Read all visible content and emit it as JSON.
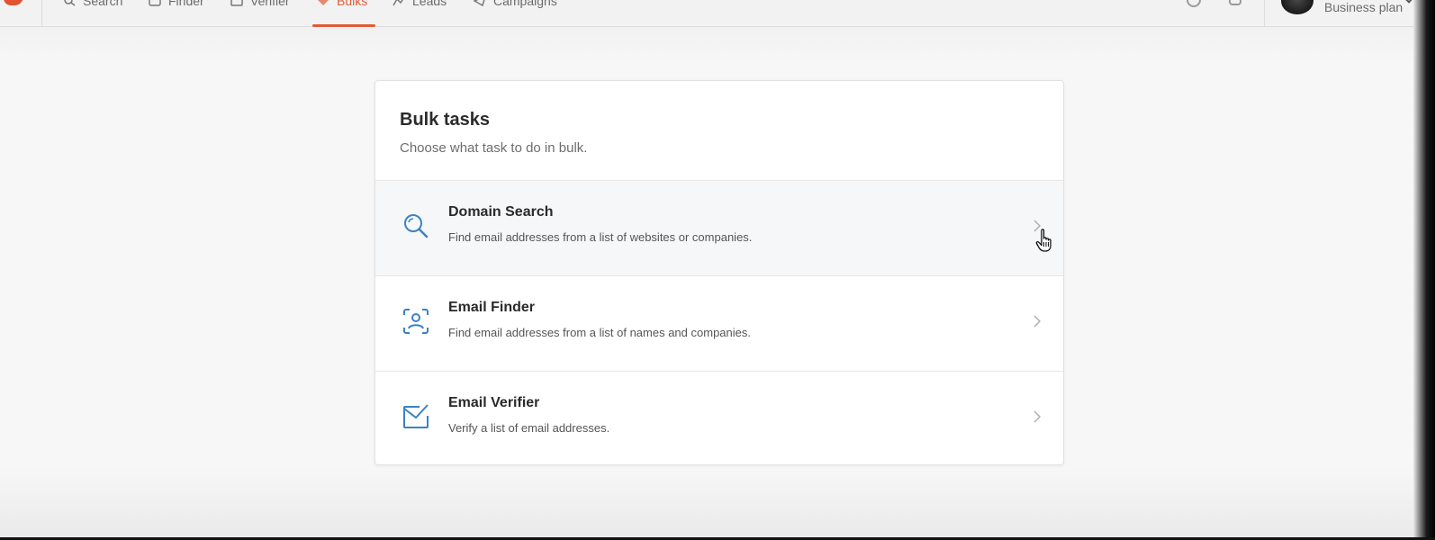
{
  "nav": {
    "items": [
      {
        "label": "Search",
        "icon": "search-icon"
      },
      {
        "label": "Finder",
        "icon": "finder-icon"
      },
      {
        "label": "Verifier",
        "icon": "verifier-icon"
      },
      {
        "label": "Bulks",
        "icon": "bulks-icon",
        "active": true
      },
      {
        "label": "Leads",
        "icon": "leads-icon"
      },
      {
        "label": "Campaigns",
        "icon": "campaigns-icon"
      }
    ],
    "plan": "Business plan"
  },
  "card": {
    "title": "Bulk tasks",
    "subtitle": "Choose what task to do in bulk.",
    "tasks": [
      {
        "title": "Domain Search",
        "description": "Find email addresses from a list of websites or companies.",
        "icon": "search-icon"
      },
      {
        "title": "Email Finder",
        "description": "Find email addresses from a list of names and companies.",
        "icon": "person-scan-icon"
      },
      {
        "title": "Email Verifier",
        "description": "Verify a list of email addresses.",
        "icon": "envelope-check-icon"
      }
    ]
  },
  "colors": {
    "accent": "#e25b3a",
    "icon_blue": "#3b82c4"
  }
}
